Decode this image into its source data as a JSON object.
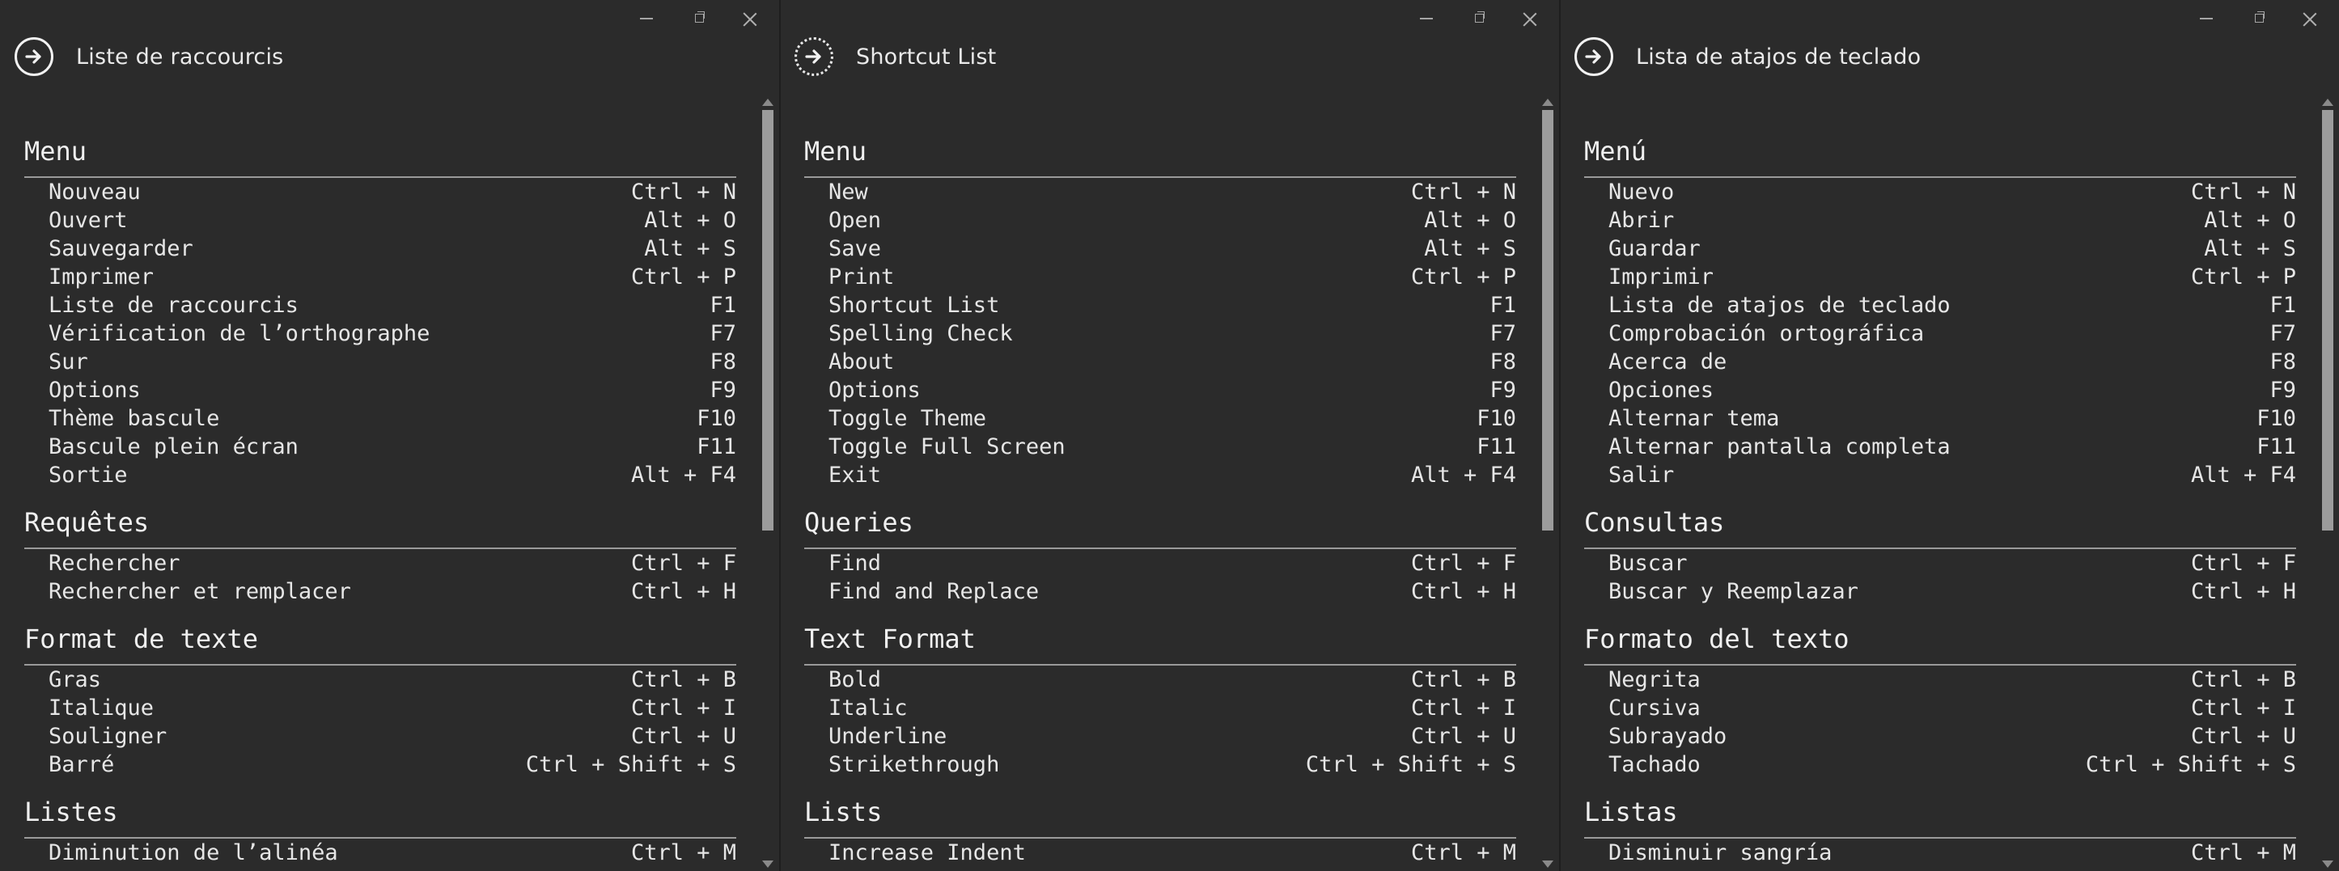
{
  "windows": [
    {
      "title": "Liste de raccourcis",
      "sections": [
        {
          "title": "Menu",
          "items": [
            {
              "label": "Nouveau",
              "keys": "Ctrl + N"
            },
            {
              "label": "Ouvert",
              "keys": "Alt + O"
            },
            {
              "label": "Sauvegarder",
              "keys": "Alt + S"
            },
            {
              "label": "Imprimer",
              "keys": "Ctrl + P"
            },
            {
              "label": "Liste de raccourcis",
              "keys": "F1"
            },
            {
              "label": "Vérification de l’orthographe",
              "keys": "F7"
            },
            {
              "label": "Sur",
              "keys": "F8"
            },
            {
              "label": "Options",
              "keys": "F9"
            },
            {
              "label": "Thème bascule",
              "keys": "F10"
            },
            {
              "label": "Bascule plein écran",
              "keys": "F11"
            },
            {
              "label": "Sortie",
              "keys": "Alt + F4"
            }
          ]
        },
        {
          "title": "Requêtes",
          "items": [
            {
              "label": "Rechercher",
              "keys": "Ctrl + F"
            },
            {
              "label": "Rechercher et remplacer",
              "keys": "Ctrl + H"
            }
          ]
        },
        {
          "title": "Format de texte",
          "items": [
            {
              "label": "Gras",
              "keys": "Ctrl + B"
            },
            {
              "label": "Italique",
              "keys": "Ctrl + I"
            },
            {
              "label": "Souligner",
              "keys": "Ctrl + U"
            },
            {
              "label": "Barré",
              "keys": "Ctrl + Shift + S"
            }
          ]
        },
        {
          "title": "Listes",
          "items": [
            {
              "label": "Diminution de l’alinéa",
              "keys": "Ctrl + M"
            }
          ]
        }
      ]
    },
    {
      "title": "Shortcut List",
      "sections": [
        {
          "title": "Menu",
          "items": [
            {
              "label": "New",
              "keys": "Ctrl + N"
            },
            {
              "label": "Open",
              "keys": "Alt + O"
            },
            {
              "label": "Save",
              "keys": "Alt + S"
            },
            {
              "label": "Print",
              "keys": "Ctrl + P"
            },
            {
              "label": "Shortcut List",
              "keys": "F1"
            },
            {
              "label": "Spelling Check",
              "keys": "F7"
            },
            {
              "label": "About",
              "keys": "F8"
            },
            {
              "label": "Options",
              "keys": "F9"
            },
            {
              "label": "Toggle Theme",
              "keys": "F10"
            },
            {
              "label": "Toggle Full Screen",
              "keys": "F11"
            },
            {
              "label": "Exit",
              "keys": "Alt + F4"
            }
          ]
        },
        {
          "title": "Queries",
          "items": [
            {
              "label": "Find",
              "keys": "Ctrl + F"
            },
            {
              "label": "Find and Replace",
              "keys": "Ctrl + H"
            }
          ]
        },
        {
          "title": "Text Format",
          "items": [
            {
              "label": "Bold",
              "keys": "Ctrl + B"
            },
            {
              "label": "Italic",
              "keys": "Ctrl + I"
            },
            {
              "label": "Underline",
              "keys": "Ctrl + U"
            },
            {
              "label": "Strikethrough",
              "keys": "Ctrl + Shift + S"
            }
          ]
        },
        {
          "title": "Lists",
          "items": [
            {
              "label": "Increase Indent",
              "keys": "Ctrl + M"
            }
          ]
        }
      ]
    },
    {
      "title": "Lista de atajos de teclado",
      "sections": [
        {
          "title": "Menú",
          "items": [
            {
              "label": "Nuevo",
              "keys": "Ctrl + N"
            },
            {
              "label": "Abrir",
              "keys": "Alt + O"
            },
            {
              "label": "Guardar",
              "keys": "Alt + S"
            },
            {
              "label": "Imprimir",
              "keys": "Ctrl + P"
            },
            {
              "label": "Lista de atajos de teclado",
              "keys": "F1"
            },
            {
              "label": "Comprobación ortográfica",
              "keys": "F7"
            },
            {
              "label": "Acerca de",
              "keys": "F8"
            },
            {
              "label": "Opciones",
              "keys": "F9"
            },
            {
              "label": "Alternar tema",
              "keys": "F10"
            },
            {
              "label": "Alternar pantalla completa",
              "keys": "F11"
            },
            {
              "label": "Salir",
              "keys": "Alt + F4"
            }
          ]
        },
        {
          "title": "Consultas",
          "items": [
            {
              "label": "Buscar",
              "keys": "Ctrl + F"
            },
            {
              "label": "Buscar y Reemplazar",
              "keys": "Ctrl + H"
            }
          ]
        },
        {
          "title": "Formato del texto",
          "items": [
            {
              "label": "Negrita",
              "keys": "Ctrl + B"
            },
            {
              "label": "Cursiva",
              "keys": "Ctrl + I"
            },
            {
              "label": "Subrayado",
              "keys": "Ctrl + U"
            },
            {
              "label": "Tachado",
              "keys": "Ctrl + Shift + S"
            }
          ]
        },
        {
          "title": "Listas",
          "items": [
            {
              "label": "Disminuir sangría",
              "keys": "Ctrl + M"
            }
          ]
        }
      ]
    }
  ]
}
